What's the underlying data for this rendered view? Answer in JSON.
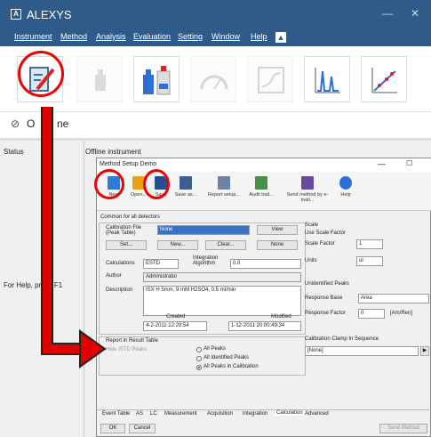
{
  "app": {
    "title": "ALEXYS",
    "logo_glyph": "A"
  },
  "window_controls": {
    "minimize": "—",
    "close": "✕"
  },
  "menu": [
    "Instrument",
    "Method",
    "Analysis",
    "Evaluation",
    "Setting",
    "Window",
    "Help"
  ],
  "toolbar_icons": [
    "method-edit-icon",
    "bottle-icon",
    "bottles-icon",
    "gauge-icon",
    "chromatogram-icon",
    "peaks-icon",
    "calibration-icon"
  ],
  "status": {
    "offline_prefix": "O",
    "offline_suffix": "ne",
    "status_label": "Status",
    "offline_instrument": "Offline instrument",
    "help_hint": "For Help, press F1"
  },
  "dialog": {
    "title": "Method Setup Demo",
    "toolbar": [
      "New",
      "Open...",
      "Save",
      "Save as...",
      "Report setup...",
      "Audit trail...",
      "Send method by e-mail...",
      "Help"
    ],
    "common_label": "Common for all detectors",
    "calibration_file_label": "Calibration File (Peak Table)",
    "calibration_file_value": "None",
    "view_btn": "View",
    "btn_row": [
      "Set...",
      "New...",
      "Clear...",
      "None"
    ],
    "calculations_label": "Calculations",
    "calculations_value": "ESTD",
    "integration_label": "Integration Algorithm",
    "integration_value": "0.0",
    "author_label": "Author",
    "author_value": "Administrator",
    "description_label": "Description",
    "description_value": "ISX H 5mm, 9 mM H2SO4, 0.5 ml/min",
    "created_label": "Created",
    "created_value": "4-2-2011 12:20:54",
    "modified_label": "Modified",
    "modified_value": "1-12-2011 20:00:49:34",
    "report_group": "Report in Result Table",
    "hide_istd": "Hide ISTD Peaks",
    "report_options": [
      "All Peaks",
      "All Identified Peaks",
      "All Peaks in Calibration"
    ],
    "scale_group": "Scale",
    "use_scale": "Use Scale Factor",
    "scale_factor_label": "Scale Factor",
    "scale_factor_value": "1",
    "units_label": "Units",
    "units_value": "ul",
    "unidentified_label": "Unidentified Peaks",
    "response_base_label": "Response Base",
    "response_base_value": "Area",
    "response_factor_label": "Response Factor",
    "response_factor_value": "0",
    "response_units": "[Am/Ren]",
    "cal_clamp_label": "Calibration Clamp In Sequence",
    "cal_clamp_value": "[None]",
    "tabs": [
      "Event Table",
      "AS",
      "LC",
      "Measurement",
      "Acquisition",
      "Integration",
      "Calculation",
      "Advanced"
    ],
    "ok_btn": "OK",
    "cancel_btn": "Cancel",
    "send_btn": "Send Method"
  },
  "colors": {
    "titlebar": "#2f5b8a",
    "highlight": "#e00000",
    "arrow": "#e00000"
  }
}
